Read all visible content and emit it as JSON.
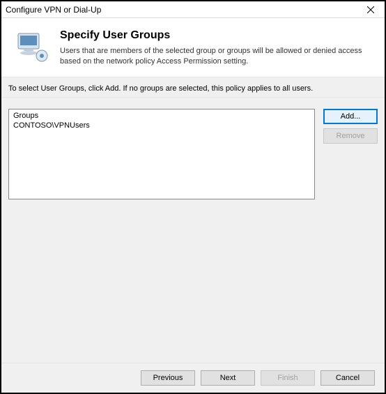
{
  "titlebar": {
    "title": "Configure VPN or Dial-Up"
  },
  "header": {
    "heading": "Specify User Groups",
    "description": "Users that are members of the selected group or groups will be allowed or denied access based on the network policy Access Permission setting."
  },
  "instruction": "To select User Groups, click Add. If no groups are selected, this policy applies to all users.",
  "groups": {
    "columnHeader": "Groups",
    "items": [
      "CONTOSO\\VPNUsers"
    ]
  },
  "buttons": {
    "add": "Add...",
    "remove": "Remove",
    "previous": "Previous",
    "next": "Next",
    "finish": "Finish",
    "cancel": "Cancel"
  }
}
